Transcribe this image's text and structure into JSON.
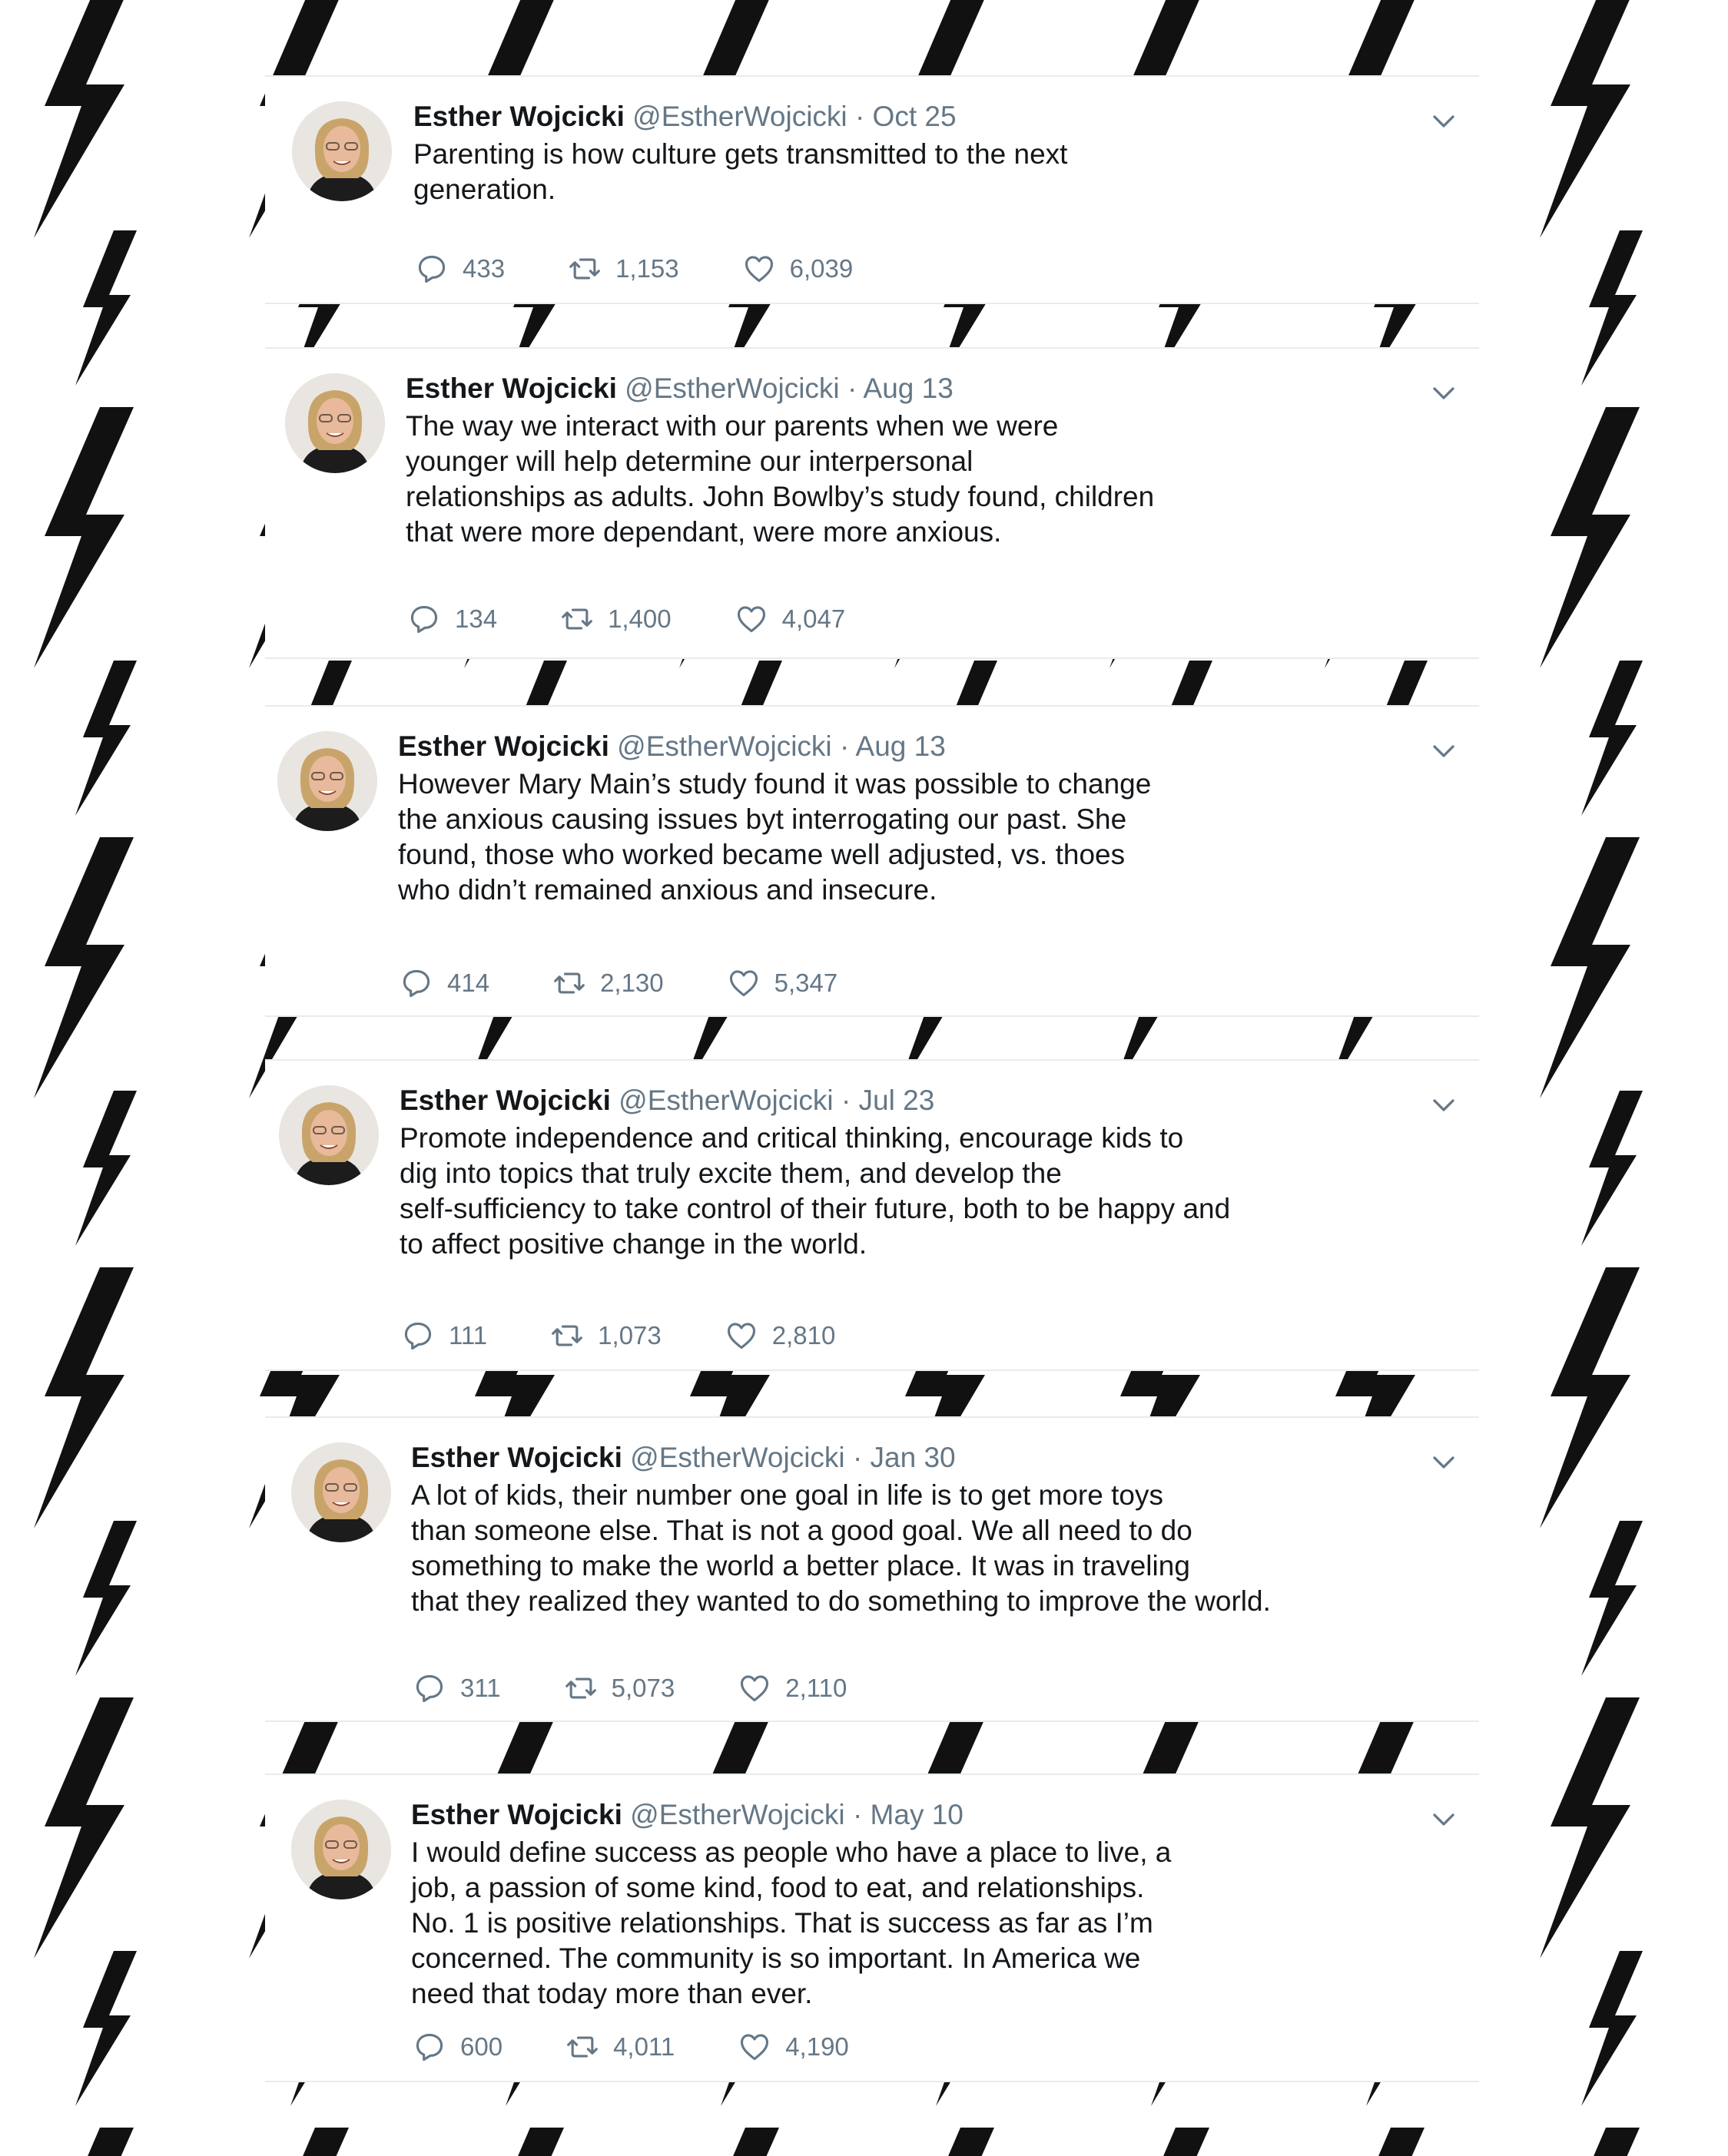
{
  "tweets": [
    {
      "name": "Esther Wojcicki",
      "handle": "@EstherWojcicki",
      "separator": "·",
      "date": "Oct 25",
      "lines": [
        "Parenting is how culture gets transmitted to the next",
        "generation."
      ],
      "replies": "433",
      "retweets": "1,153",
      "likes": "6,039"
    },
    {
      "name": "Esther Wojcicki",
      "handle": "@EstherWojcicki",
      "separator": "·",
      "date": "Aug 13",
      "lines": [
        "The way we interact with our parents when we were",
        "younger will help determine our interpersonal",
        "relationships as adults. John Bowlby’s study found, children",
        "that were more dependant, were more anxious."
      ],
      "replies": "134",
      "retweets": "1,400",
      "likes": "4,047"
    },
    {
      "name": "Esther Wojcicki",
      "handle": "@EstherWojcicki",
      "separator": "·",
      "date": "Aug 13",
      "lines": [
        "However Mary Main’s study found it was possible to change",
        "the anxious causing issues byt interrogating our past. She",
        "found, those who worked became well adjusted, vs. thoes",
        "who didn’t remained anxious and insecure."
      ],
      "replies": "414",
      "retweets": "2,130",
      "likes": "5,347"
    },
    {
      "name": "Esther Wojcicki",
      "handle": "@EstherWojcicki",
      "separator": "·",
      "date": "Jul 23",
      "lines": [
        "Promote independence and critical thinking, encourage kids to",
        "dig into topics that truly excite them, and develop the",
        "self-sufficiency to take control of their future, both to be happy and",
        "to affect positive change in the world."
      ],
      "replies": "111",
      "retweets": "1,073",
      "likes": "2,810"
    },
    {
      "name": "Esther Wojcicki",
      "handle": "@EstherWojcicki",
      "separator": "·",
      "date": "Jan 30",
      "lines": [
        "A lot of kids, their number one goal in life is to get more toys",
        "than someone else. That is not a good goal. We all need to do",
        "something to make the world a better place. It was in traveling",
        "that they realized they wanted to do something to improve the world."
      ],
      "replies": "311",
      "retweets": "5,073",
      "likes": "2,110"
    },
    {
      "name": "Esther Wojcicki",
      "handle": "@EstherWojcicki",
      "separator": "·",
      "date": "May 10",
      "lines": [
        "I would define success as people who have a place to live, a",
        "job, a passion of some kind, food to eat, and relationships.",
        "No. 1 is positive relationships. That is success as far as I’m",
        "concerned. The community is so important. In America we",
        "need that today more than ever."
      ],
      "replies": "600",
      "retweets": "4,011",
      "likes": "4,190"
    }
  ],
  "icons": {
    "reply": "reply-icon",
    "retweet": "retweet-icon",
    "like": "heart-icon",
    "menu": "chevron-down-icon"
  },
  "colors": {
    "text": "#14171a",
    "muted": "#657786",
    "divider": "#e6ecf0",
    "background_pattern": "#111111"
  }
}
